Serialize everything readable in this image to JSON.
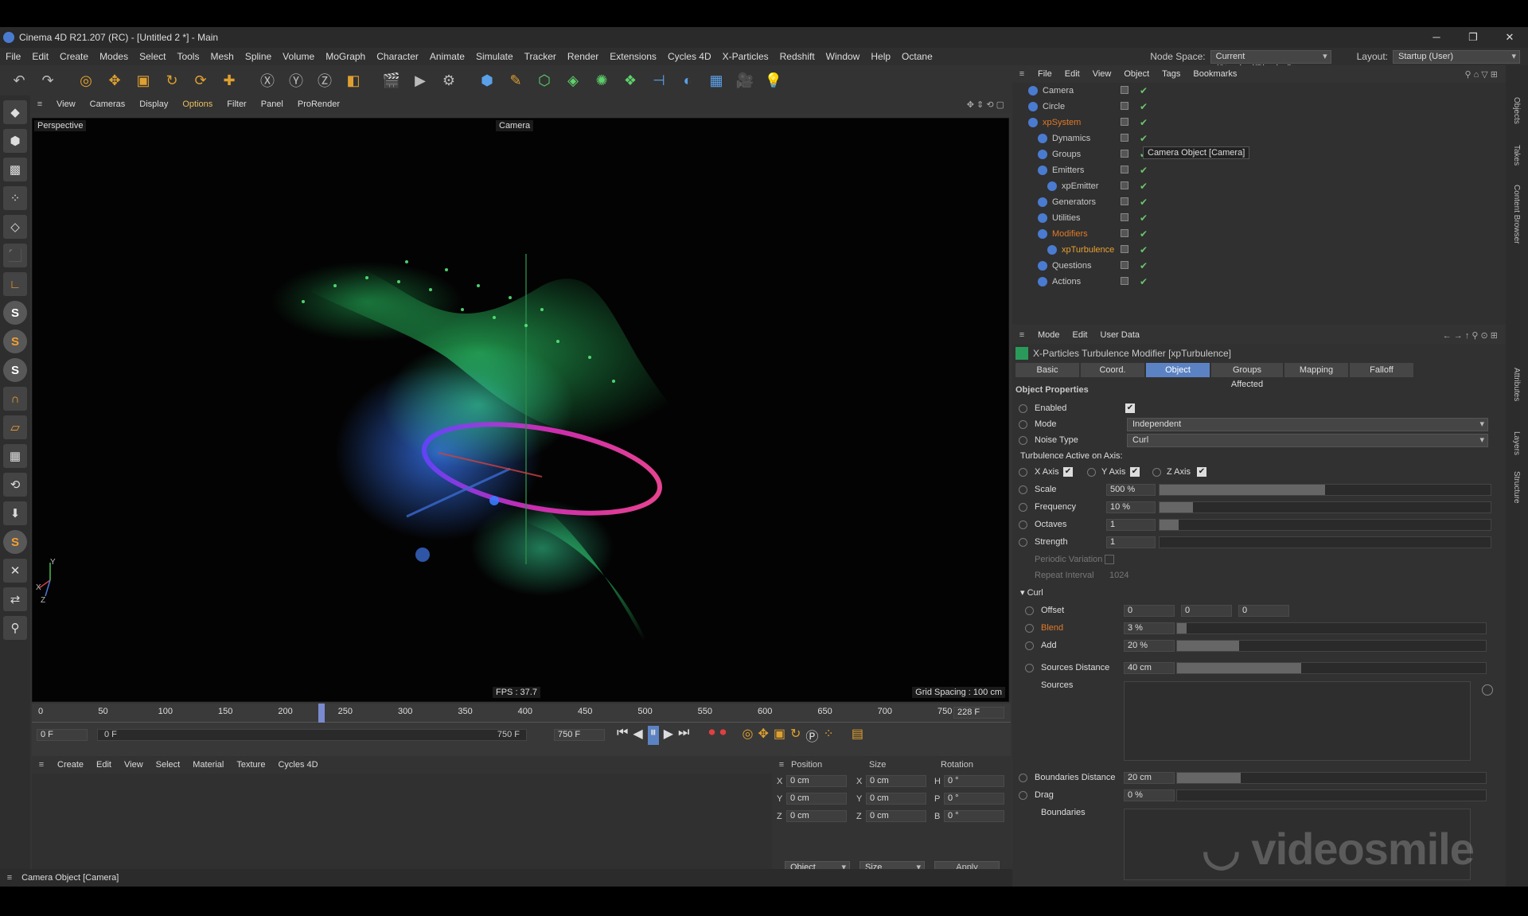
{
  "window": {
    "title": "Cinema 4D R21.207 (RC) - [Untitled 2 *] - Main"
  },
  "menubar": {
    "items": [
      "File",
      "Edit",
      "Create",
      "Modes",
      "Select",
      "Tools",
      "Mesh",
      "Spline",
      "Volume",
      "MoGraph",
      "Character",
      "Animate",
      "Simulate",
      "Tracker",
      "Render",
      "Extensions",
      "Cycles 4D",
      "X-Particles",
      "Redshift",
      "Window",
      "Help",
      "Octane"
    ],
    "node_space_label": "Node Space:",
    "node_space_value": "Current (Standard/Physical)",
    "layout_label": "Layout:",
    "layout_value": "Startup (User)"
  },
  "viewport": {
    "menu": [
      "View",
      "Cameras",
      "Display",
      "Options",
      "Filter",
      "Panel",
      "ProRender"
    ],
    "view_name": "Perspective",
    "camera_label": "Camera",
    "fps": "FPS : 37.7",
    "grid_spacing": "Grid Spacing : 100 cm",
    "axis_y": "Y",
    "axis_x": "X",
    "axis_z": "Z"
  },
  "timeline": {
    "ticks": [
      "0",
      "50",
      "100",
      "150",
      "200",
      "250",
      "300",
      "350",
      "400",
      "450",
      "500",
      "550",
      "600",
      "650",
      "700",
      "750"
    ],
    "current_frame": "228 F",
    "start_field": "0 F",
    "range_start": "0 F",
    "range_end": "750 F",
    "end_field": "750 F"
  },
  "material_manager": {
    "menu": [
      "Create",
      "Edit",
      "View",
      "Select",
      "Material",
      "Texture",
      "Cycles 4D"
    ]
  },
  "coordinates": {
    "headers": [
      "Position",
      "Size",
      "Rotation"
    ],
    "rows": [
      {
        "axis": "X",
        "pos": "0 cm",
        "size_axis": "X",
        "size": "0 cm",
        "rot_axis": "H",
        "rot": "0 °"
      },
      {
        "axis": "Y",
        "pos": "0 cm",
        "size_axis": "Y",
        "size": "0 cm",
        "rot_axis": "P",
        "rot": "0 °"
      },
      {
        "axis": "Z",
        "pos": "0 cm",
        "size_axis": "Z",
        "size": "0 cm",
        "rot_axis": "B",
        "rot": "0 °"
      }
    ],
    "mode": "Object (Rel)",
    "size_mode": "Size",
    "apply": "Apply"
  },
  "statusbar": {
    "text": "Camera Object [Camera]"
  },
  "object_manager": {
    "menu": [
      "File",
      "Edit",
      "View",
      "Object",
      "Tags",
      "Bookmarks"
    ],
    "tooltip": "Camera Object [Camera]",
    "objects": [
      {
        "name": "Camera",
        "indent": 0,
        "color": "#c8c8c8"
      },
      {
        "name": "Circle",
        "indent": 0,
        "color": "#c8c8c8"
      },
      {
        "name": "xpSystem",
        "indent": 0,
        "color": "#e07a28"
      },
      {
        "name": "Dynamics",
        "indent": 1,
        "color": "#c8c8c8"
      },
      {
        "name": "Groups",
        "indent": 1,
        "color": "#c8c8c8"
      },
      {
        "name": "Emitters",
        "indent": 1,
        "color": "#c8c8c8"
      },
      {
        "name": "xpEmitter",
        "indent": 2,
        "color": "#c8c8c8"
      },
      {
        "name": "Generators",
        "indent": 1,
        "color": "#c8c8c8"
      },
      {
        "name": "Utilities",
        "indent": 1,
        "color": "#c8c8c8"
      },
      {
        "name": "Modifiers",
        "indent": 1,
        "color": "#e07a28"
      },
      {
        "name": "xpTurbulence",
        "indent": 2,
        "color": "#e8a030"
      },
      {
        "name": "Questions",
        "indent": 1,
        "color": "#c8c8c8"
      },
      {
        "name": "Actions",
        "indent": 1,
        "color": "#c8c8c8"
      }
    ]
  },
  "attributes": {
    "menu": [
      "Mode",
      "Edit",
      "User Data"
    ],
    "title": "X-Particles Turbulence Modifier [xpTurbulence]",
    "tabs": [
      "Basic",
      "Coord.",
      "Object",
      "Groups Affected",
      "Mapping",
      "Falloff"
    ],
    "active_tab": "Object",
    "section": "Object Properties",
    "enabled_label": "Enabled",
    "mode_label": "Mode",
    "mode_value": "Independent",
    "noise_label": "Noise Type",
    "noise_value": "Curl",
    "axis_section": "Turbulence Active on Axis:",
    "x_axis": "X Axis",
    "y_axis": "Y Axis",
    "z_axis": "Z Axis",
    "scale_label": "Scale",
    "scale_value": "500 %",
    "scale_level": 0.5,
    "frequency_label": "Frequency",
    "frequency_value": "10 %",
    "frequency_level": 0.1,
    "octaves_label": "Octaves",
    "octaves_value": "1",
    "strength_label": "Strength",
    "strength_value": "1",
    "periodic_label": "Periodic Variation",
    "repeat_label": "Repeat Interval",
    "repeat_value": "1024",
    "curl_section": "Curl",
    "offset_label": "Offset",
    "offset_values": [
      "0",
      "0",
      "0"
    ],
    "blend_label": "Blend",
    "blend_value": "3 %",
    "blend_level": 0.03,
    "add_label": "Add",
    "add_value": "20 %",
    "add_level": 0.2,
    "sources_distance_label": "Sources Distance",
    "sources_distance_value": "40 cm",
    "sources_label": "Sources",
    "boundaries_distance_label": "Boundaries Distance",
    "boundaries_distance_value": "20 cm",
    "drag_label": "Drag",
    "drag_value": "0 %",
    "boundaries_label": "Boundaries"
  },
  "right_strip": [
    "Objects",
    "Takes",
    "Content Browser",
    "Attributes",
    "Layers",
    "Structure"
  ],
  "watermark": "videosmile"
}
